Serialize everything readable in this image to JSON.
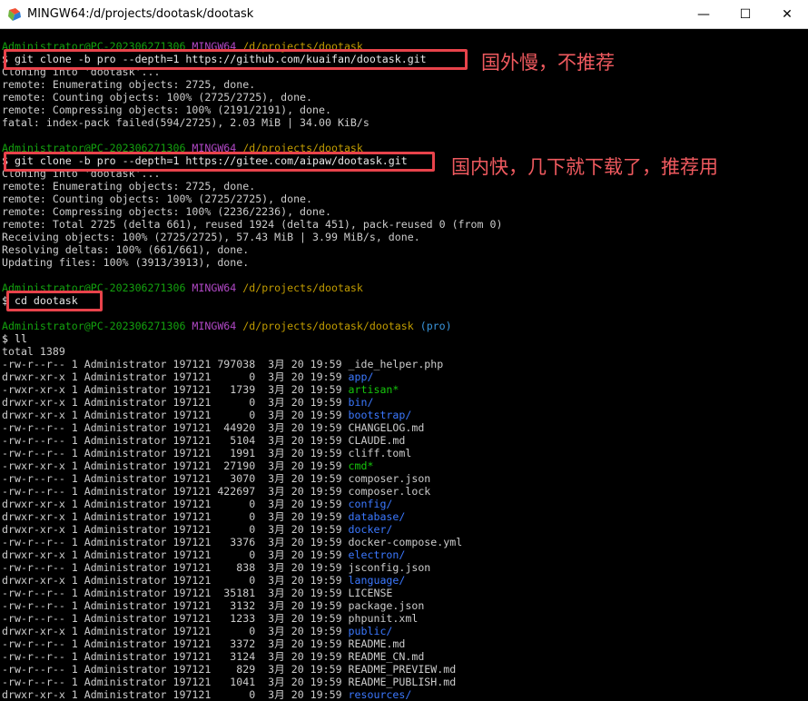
{
  "window": {
    "title": "MINGW64:/d/projects/dootask/dootask",
    "minimize_icon": "—",
    "maximize_icon": "☐",
    "close_icon": "✕"
  },
  "terminal": {
    "prompt1": {
      "user": "Administrator@PC-202306271306",
      "env": "MINGW64",
      "path": "/d/projects/dootask",
      "branch": ""
    },
    "cmd1": "$ git clone -b pro --depth=1 https://github.com/kuaifan/dootask.git",
    "out1": [
      "Cloning into 'dootask'...",
      "remote: Enumerating objects: 2725, done.",
      "remote: Counting objects: 100% (2725/2725), done.",
      "remote: Compressing objects: 100% (2191/2191), done.",
      "fatal: index-pack failed(594/2725), 2.03 MiB | 34.00 KiB/s"
    ],
    "prompt2": {
      "user": "Administrator@PC-202306271306",
      "env": "MINGW64",
      "path": "/d/projects/dootask",
      "branch": ""
    },
    "cmd2": "$ git clone -b pro --depth=1 https://gitee.com/aipaw/dootask.git",
    "out2": [
      "Cloning into 'dootask'...",
      "remote: Enumerating objects: 2725, done.",
      "remote: Counting objects: 100% (2725/2725), done.",
      "remote: Compressing objects: 100% (2236/2236), done.",
      "remote: Total 2725 (delta 661), reused 1924 (delta 451), pack-reused 0 (from 0)",
      "Receiving objects: 100% (2725/2725), 57.43 MiB | 3.99 MiB/s, done.",
      "Resolving deltas: 100% (661/661), done.",
      "Updating files: 100% (3913/3913), done."
    ],
    "prompt3": {
      "user": "Administrator@PC-202306271306",
      "env": "MINGW64",
      "path": "/d/projects/dootask",
      "branch": ""
    },
    "cmd3": "$ cd dootask",
    "prompt4": {
      "user": "Administrator@PC-202306271306",
      "env": "MINGW64",
      "path": "/d/projects/dootask/dootask",
      "branch": "(pro)"
    },
    "cmd4": "$ ll",
    "total": "total 1389",
    "files": [
      {
        "perm": "-rw-r--r--",
        "links": "1",
        "owner": "Administrator",
        "group": "197121",
        "size": "797038",
        "month": "3月",
        "day": "20",
        "time": "19:59",
        "name": "_ide_helper.php",
        "type": "file"
      },
      {
        "perm": "drwxr-xr-x",
        "links": "1",
        "owner": "Administrator",
        "group": "197121",
        "size": "0",
        "month": "3月",
        "day": "20",
        "time": "19:59",
        "name": "app/",
        "type": "dir"
      },
      {
        "perm": "-rwxr-xr-x",
        "links": "1",
        "owner": "Administrator",
        "group": "197121",
        "size": "1739",
        "month": "3月",
        "day": "20",
        "time": "19:59",
        "name": "artisan*",
        "type": "exec"
      },
      {
        "perm": "drwxr-xr-x",
        "links": "1",
        "owner": "Administrator",
        "group": "197121",
        "size": "0",
        "month": "3月",
        "day": "20",
        "time": "19:59",
        "name": "bin/",
        "type": "dir"
      },
      {
        "perm": "drwxr-xr-x",
        "links": "1",
        "owner": "Administrator",
        "group": "197121",
        "size": "0",
        "month": "3月",
        "day": "20",
        "time": "19:59",
        "name": "bootstrap/",
        "type": "dir"
      },
      {
        "perm": "-rw-r--r--",
        "links": "1",
        "owner": "Administrator",
        "group": "197121",
        "size": "44920",
        "month": "3月",
        "day": "20",
        "time": "19:59",
        "name": "CHANGELOG.md",
        "type": "file"
      },
      {
        "perm": "-rw-r--r--",
        "links": "1",
        "owner": "Administrator",
        "group": "197121",
        "size": "5104",
        "month": "3月",
        "day": "20",
        "time": "19:59",
        "name": "CLAUDE.md",
        "type": "file"
      },
      {
        "perm": "-rw-r--r--",
        "links": "1",
        "owner": "Administrator",
        "group": "197121",
        "size": "1991",
        "month": "3月",
        "day": "20",
        "time": "19:59",
        "name": "cliff.toml",
        "type": "file"
      },
      {
        "perm": "-rwxr-xr-x",
        "links": "1",
        "owner": "Administrator",
        "group": "197121",
        "size": "27190",
        "month": "3月",
        "day": "20",
        "time": "19:59",
        "name": "cmd*",
        "type": "exec"
      },
      {
        "perm": "-rw-r--r--",
        "links": "1",
        "owner": "Administrator",
        "group": "197121",
        "size": "3070",
        "month": "3月",
        "day": "20",
        "time": "19:59",
        "name": "composer.json",
        "type": "file"
      },
      {
        "perm": "-rw-r--r--",
        "links": "1",
        "owner": "Administrator",
        "group": "197121",
        "size": "422697",
        "month": "3月",
        "day": "20",
        "time": "19:59",
        "name": "composer.lock",
        "type": "file"
      },
      {
        "perm": "drwxr-xr-x",
        "links": "1",
        "owner": "Administrator",
        "group": "197121",
        "size": "0",
        "month": "3月",
        "day": "20",
        "time": "19:59",
        "name": "config/",
        "type": "dir"
      },
      {
        "perm": "drwxr-xr-x",
        "links": "1",
        "owner": "Administrator",
        "group": "197121",
        "size": "0",
        "month": "3月",
        "day": "20",
        "time": "19:59",
        "name": "database/",
        "type": "dir"
      },
      {
        "perm": "drwxr-xr-x",
        "links": "1",
        "owner": "Administrator",
        "group": "197121",
        "size": "0",
        "month": "3月",
        "day": "20",
        "time": "19:59",
        "name": "docker/",
        "type": "dir"
      },
      {
        "perm": "-rw-r--r--",
        "links": "1",
        "owner": "Administrator",
        "group": "197121",
        "size": "3376",
        "month": "3月",
        "day": "20",
        "time": "19:59",
        "name": "docker-compose.yml",
        "type": "file"
      },
      {
        "perm": "drwxr-xr-x",
        "links": "1",
        "owner": "Administrator",
        "group": "197121",
        "size": "0",
        "month": "3月",
        "day": "20",
        "time": "19:59",
        "name": "electron/",
        "type": "dir"
      },
      {
        "perm": "-rw-r--r--",
        "links": "1",
        "owner": "Administrator",
        "group": "197121",
        "size": "838",
        "month": "3月",
        "day": "20",
        "time": "19:59",
        "name": "jsconfig.json",
        "type": "file"
      },
      {
        "perm": "drwxr-xr-x",
        "links": "1",
        "owner": "Administrator",
        "group": "197121",
        "size": "0",
        "month": "3月",
        "day": "20",
        "time": "19:59",
        "name": "language/",
        "type": "dir"
      },
      {
        "perm": "-rw-r--r--",
        "links": "1",
        "owner": "Administrator",
        "group": "197121",
        "size": "35181",
        "month": "3月",
        "day": "20",
        "time": "19:59",
        "name": "LICENSE",
        "type": "file"
      },
      {
        "perm": "-rw-r--r--",
        "links": "1",
        "owner": "Administrator",
        "group": "197121",
        "size": "3132",
        "month": "3月",
        "day": "20",
        "time": "19:59",
        "name": "package.json",
        "type": "file"
      },
      {
        "perm": "-rw-r--r--",
        "links": "1",
        "owner": "Administrator",
        "group": "197121",
        "size": "1233",
        "month": "3月",
        "day": "20",
        "time": "19:59",
        "name": "phpunit.xml",
        "type": "file"
      },
      {
        "perm": "drwxr-xr-x",
        "links": "1",
        "owner": "Administrator",
        "group": "197121",
        "size": "0",
        "month": "3月",
        "day": "20",
        "time": "19:59",
        "name": "public/",
        "type": "dir"
      },
      {
        "perm": "-rw-r--r--",
        "links": "1",
        "owner": "Administrator",
        "group": "197121",
        "size": "3372",
        "month": "3月",
        "day": "20",
        "time": "19:59",
        "name": "README.md",
        "type": "file"
      },
      {
        "perm": "-rw-r--r--",
        "links": "1",
        "owner": "Administrator",
        "group": "197121",
        "size": "3124",
        "month": "3月",
        "day": "20",
        "time": "19:59",
        "name": "README_CN.md",
        "type": "file"
      },
      {
        "perm": "-rw-r--r--",
        "links": "1",
        "owner": "Administrator",
        "group": "197121",
        "size": "829",
        "month": "3月",
        "day": "20",
        "time": "19:59",
        "name": "README_PREVIEW.md",
        "type": "file"
      },
      {
        "perm": "-rw-r--r--",
        "links": "1",
        "owner": "Administrator",
        "group": "197121",
        "size": "1041",
        "month": "3月",
        "day": "20",
        "time": "19:59",
        "name": "README_PUBLISH.md",
        "type": "file"
      },
      {
        "perm": "drwxr-xr-x",
        "links": "1",
        "owner": "Administrator",
        "group": "197121",
        "size": "0",
        "month": "3月",
        "day": "20",
        "time": "19:59",
        "name": "resources/",
        "type": "dir"
      }
    ]
  },
  "annotations": {
    "github_note": "国外慢，不推荐",
    "gitee_note": "国内快，几下就下载了，推荐用"
  },
  "colors": {
    "prompt_user": "#13a10e",
    "prompt_env": "#b148c6",
    "prompt_path": "#c19c00",
    "prompt_branch": "#3a96dd",
    "dir": "#3b78ff",
    "exec": "#16c60c",
    "highlight": "#e8434b"
  }
}
